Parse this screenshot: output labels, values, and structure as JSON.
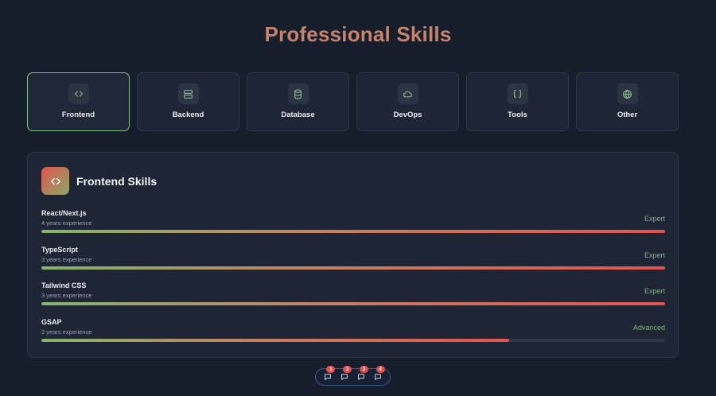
{
  "page": {
    "title": "Professional Skills"
  },
  "tabs": [
    {
      "label": "Frontend",
      "icon": "code-icon"
    },
    {
      "label": "Backend",
      "icon": "server-icon"
    },
    {
      "label": "Database",
      "icon": "database-icon"
    },
    {
      "label": "DevOps",
      "icon": "cloud-icon"
    },
    {
      "label": "Tools",
      "icon": "braces-icon"
    },
    {
      "label": "Other",
      "icon": "globe-icon"
    }
  ],
  "active_tab": "Frontend",
  "panel": {
    "title": "Frontend Skills",
    "icon": "code-icon",
    "skills": [
      {
        "name": "React/Next.js",
        "experience": "4 years experience",
        "level": "Expert",
        "progress": 1.0
      },
      {
        "name": "TypeScript",
        "experience": "3 years experience",
        "level": "Expert",
        "progress": 1.0
      },
      {
        "name": "Tailwind CSS",
        "experience": "3 years experience",
        "level": "Expert",
        "progress": 1.0
      },
      {
        "name": "GSAP",
        "experience": "2 years experience",
        "level": "Advanced",
        "progress": 0.75
      }
    ]
  },
  "pager": {
    "items": [
      {
        "badge": "1",
        "icon": "chat-icon"
      },
      {
        "badge": "2",
        "icon": "chat-icon"
      },
      {
        "badge": "3",
        "icon": "chat-icon"
      },
      {
        "badge": "4",
        "icon": "chat-icon"
      }
    ]
  },
  "colors": {
    "background": "#161d2b",
    "title": "#c6826a",
    "active_border": "#86c08a",
    "level_text": "#7fb07f",
    "bar_start": "#84b56d",
    "bar_end": "#e5524f",
    "badge": "#e04e4e"
  }
}
